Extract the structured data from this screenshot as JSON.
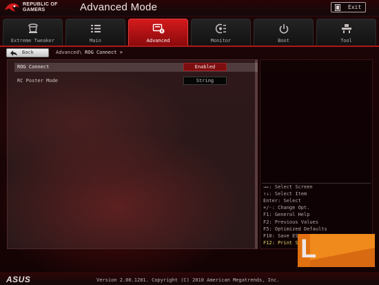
{
  "header": {
    "brand_line1": "REPUBLIC OF",
    "brand_line2": "GAMERS",
    "title": "Advanced Mode",
    "exit_label": "Exit"
  },
  "tabs": [
    {
      "label": "Extreme Tweaker",
      "icon": "tweaker-icon",
      "active": false
    },
    {
      "label": "Main",
      "icon": "list-icon",
      "active": false
    },
    {
      "label": "Advanced",
      "icon": "advanced-info-icon",
      "active": true
    },
    {
      "label": "Monitor",
      "icon": "monitor-fan-icon",
      "active": false
    },
    {
      "label": "Boot",
      "icon": "power-icon",
      "active": false
    },
    {
      "label": "Tool",
      "icon": "tool-icon",
      "active": false
    }
  ],
  "nav": {
    "back_label": "Back",
    "breadcrumb_parent": "Advanced\\",
    "breadcrumb_current": "ROG Connect >"
  },
  "settings": [
    {
      "label": "ROG Connect",
      "value": "Enabled",
      "selected": true
    },
    {
      "label": "RC Poster Mode",
      "value": "String",
      "selected": false
    }
  ],
  "help": [
    "→←: Select Screen",
    "↑↓: Select Item",
    "Enter: Select",
    "+/-: Change Opt.",
    "F1: General Help",
    "F2: Previous Values",
    "F5: Optimized Defaults",
    "F10: Save  ESC: Exit",
    "F12: Print Screen"
  ],
  "watermark": {
    "letter": "L"
  },
  "footer": {
    "logo": "ASUS",
    "version": "Version 2.00.1201. Copyright (C) 2010 American Megatrends, Inc."
  },
  "colors": {
    "accent_red": "#c8181a",
    "selected_value_bg": "#7d0e10",
    "help_highlight": "#e9d46a"
  }
}
